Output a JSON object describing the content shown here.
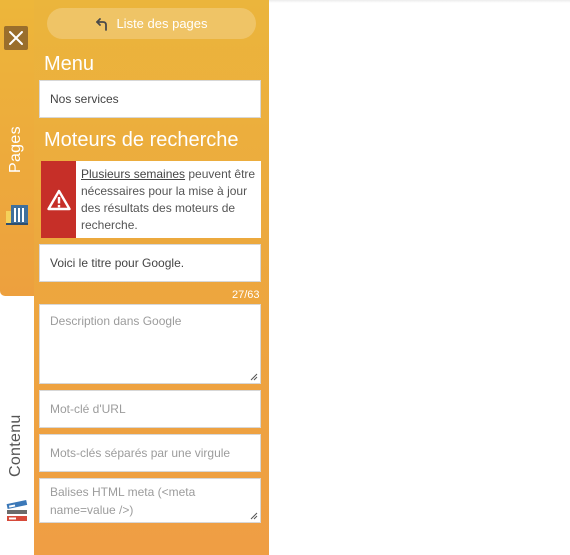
{
  "app": {
    "close_icon": "close-icon",
    "rail_tabs": [
      {
        "label": "Pages",
        "icon": "pages-icon"
      },
      {
        "label": "Contenu",
        "icon": "content-icon"
      }
    ]
  },
  "panel": {
    "back_button": {
      "label": "Liste des pages",
      "icon": "return-arrow-icon"
    },
    "menu": {
      "title": "Menu",
      "value": "Nos services"
    },
    "seo": {
      "title": "Moteurs de recherche",
      "warning": {
        "icon": "warning-icon",
        "link_text": "Plusieurs semaines",
        "text": " peuvent être nécessaires pour la mise à jour des résultats des moteurs de recherche."
      },
      "google_title": {
        "value": "Voici le titre pour Google.",
        "counter": "27/63"
      },
      "description": {
        "placeholder": "Description dans Google"
      },
      "url_keyword": {
        "placeholder": "Mot-clé d'URL"
      },
      "keywords": {
        "placeholder": "Mots-clés séparés par une virgule"
      },
      "meta": {
        "placeholder": "Balises HTML meta (<meta name=value />)"
      }
    }
  },
  "colors": {
    "panel": "#eda63e",
    "warning": "#c62f28",
    "close": "#9a6e2c"
  }
}
